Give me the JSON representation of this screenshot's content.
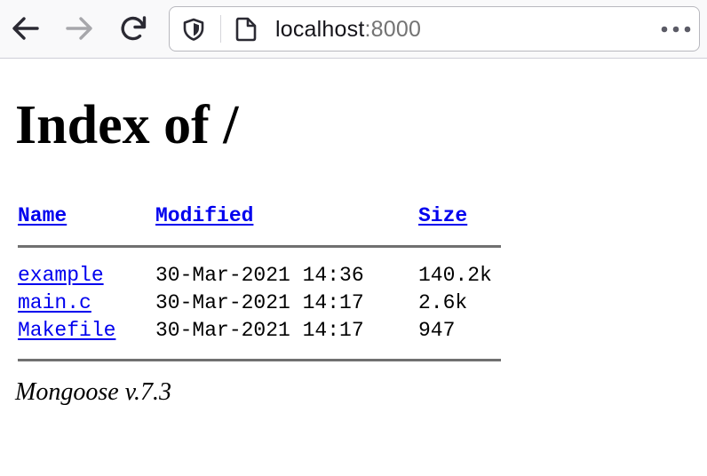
{
  "browser": {
    "url_host": "localhost",
    "url_port": ":8000",
    "icons": [
      "back-arrow-icon",
      "forward-arrow-icon",
      "reload-icon",
      "shield-icon",
      "page-icon",
      "more-icon"
    ],
    "forward_disabled": true
  },
  "page": {
    "heading": "Index of /",
    "columns": {
      "name": "Name",
      "modified": "Modified",
      "size": "Size"
    },
    "rows": [
      {
        "name": "example",
        "modified": "30-Mar-2021 14:36",
        "size": "140.2k"
      },
      {
        "name": "main.c",
        "modified": "30-Mar-2021 14:17",
        "size": "2.6k"
      },
      {
        "name": "Makefile",
        "modified": "30-Mar-2021 14:17",
        "size": "947"
      }
    ],
    "footer": "Mongoose v.7.3"
  },
  "colors": {
    "link": "#0000ee",
    "rule": "#707070",
    "toolbar_bg": "#f9f9fa"
  }
}
